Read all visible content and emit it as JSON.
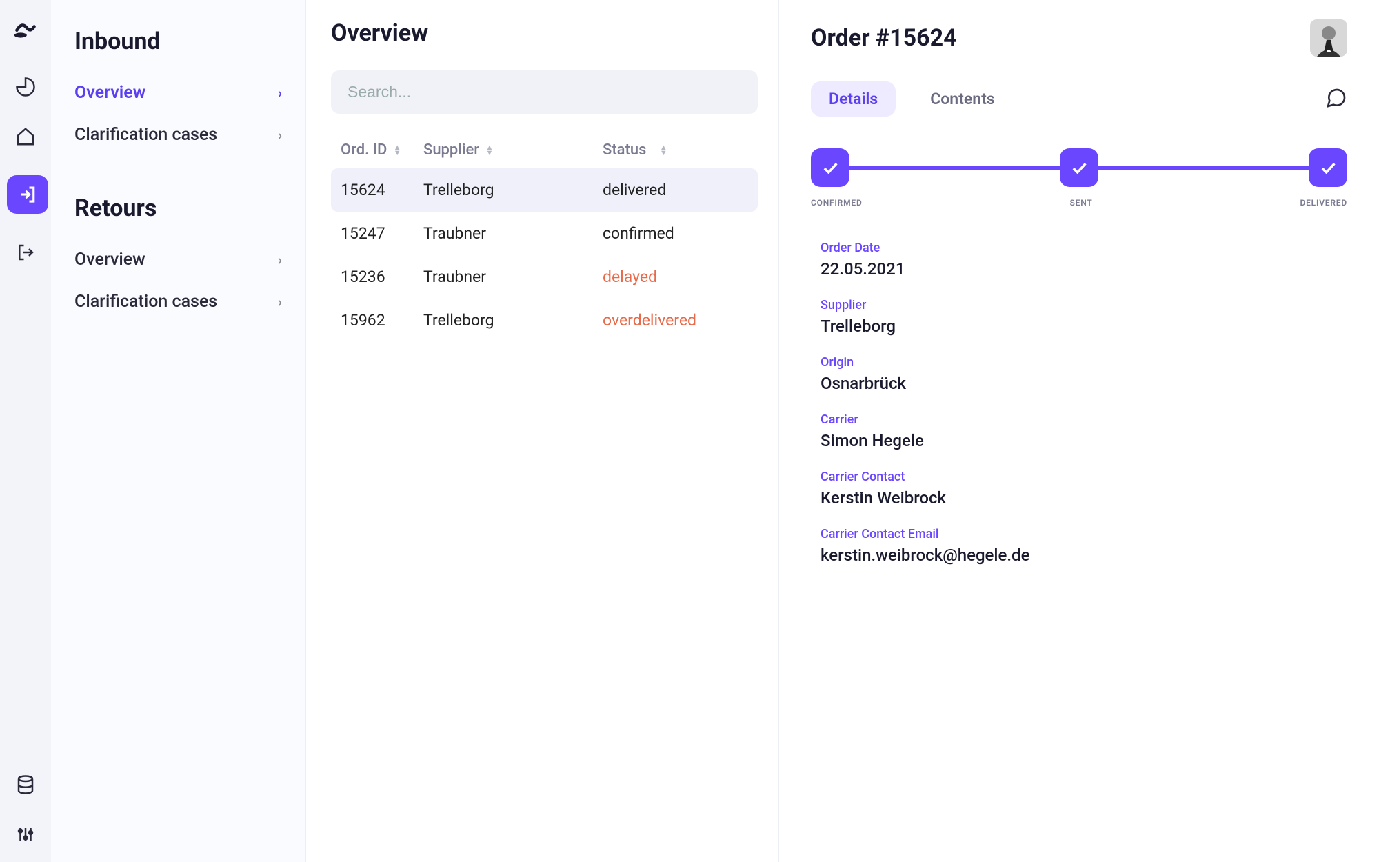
{
  "sidebar": {
    "sections": [
      {
        "title": "Inbound",
        "items": [
          {
            "label": "Overview",
            "active": true
          },
          {
            "label": "Clarification cases",
            "active": false
          }
        ]
      },
      {
        "title": "Retours",
        "items": [
          {
            "label": "Overview",
            "active": false
          },
          {
            "label": "Clarification cases",
            "active": false
          }
        ]
      }
    ]
  },
  "list": {
    "title": "Overview",
    "search_placeholder": "Search...",
    "columns": {
      "id": "Ord. ID",
      "supplier": "Supplier",
      "status": "Status"
    },
    "rows": [
      {
        "id": "15624",
        "supplier": "Trelleborg",
        "status": "delivered",
        "warn": false,
        "selected": true
      },
      {
        "id": "15247",
        "supplier": "Traubner",
        "status": "confirmed",
        "warn": false,
        "selected": false
      },
      {
        "id": "15236",
        "supplier": "Traubner",
        "status": "delayed",
        "warn": true,
        "selected": false
      },
      {
        "id": "15962",
        "supplier": "Trelleborg",
        "status": "overdelivered",
        "warn": true,
        "selected": false
      }
    ]
  },
  "detail": {
    "title": "Order #15624",
    "tabs": [
      {
        "label": "Details",
        "active": true
      },
      {
        "label": "Contents",
        "active": false
      }
    ],
    "steps": [
      {
        "label": "CONFIRMED"
      },
      {
        "label": "SENT"
      },
      {
        "label": "DELIVERED"
      }
    ],
    "fields": [
      {
        "label": "Order Date",
        "value": "22.05.2021"
      },
      {
        "label": "Supplier",
        "value": "Trelleborg"
      },
      {
        "label": "Origin",
        "value": "Osnarbrück"
      },
      {
        "label": "Carrier",
        "value": "Simon Hegele"
      },
      {
        "label": "Carrier Contact",
        "value": "Kerstin Weibrock"
      },
      {
        "label": "Carrier Contact Email",
        "value": "kerstin.weibrock@hegele.de"
      }
    ]
  }
}
